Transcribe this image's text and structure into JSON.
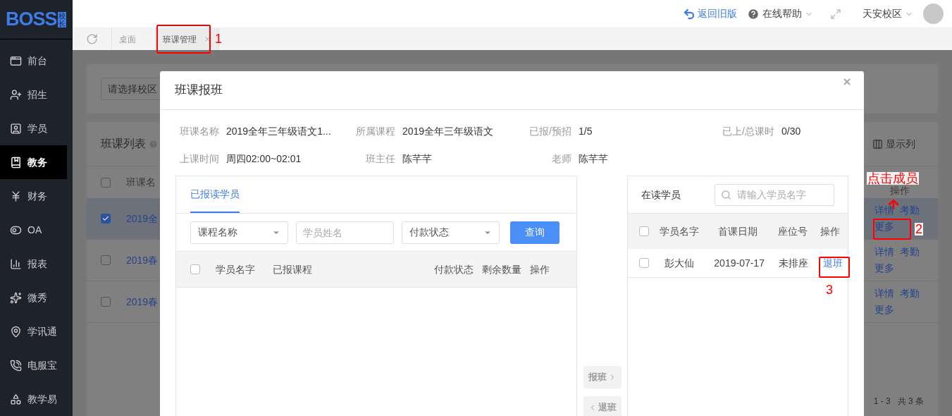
{
  "sidebar": {
    "logo": "BOSS",
    "logo_badge": "校长",
    "items": [
      {
        "label": "前台",
        "selected": false
      },
      {
        "label": "招生",
        "selected": false
      },
      {
        "label": "学员",
        "selected": false
      },
      {
        "label": "教务",
        "selected": true
      },
      {
        "label": "财务",
        "selected": false
      },
      {
        "label": "OA",
        "selected": false
      },
      {
        "label": "报表",
        "selected": false
      },
      {
        "label": "微秀",
        "selected": false
      },
      {
        "label": "学讯通",
        "selected": false
      },
      {
        "label": "电服宝",
        "selected": false
      },
      {
        "label": "教学易",
        "selected": false
      }
    ]
  },
  "topbar": {
    "back_link": "返回旧版",
    "help": "在线帮助",
    "campus": "天安校区"
  },
  "tabs": [
    {
      "label": "桌面",
      "selected": false,
      "closable": false
    },
    {
      "label": "班课管理",
      "selected": true,
      "closable": true
    }
  ],
  "page": {
    "campus_select": "请选择校区",
    "list_title": "班课列表",
    "columns_toggle": "显示列",
    "table": {
      "header_checked": false,
      "columns": [
        "班课名",
        "操作"
      ],
      "rows": [
        {
          "name": "2019全",
          "checked": true,
          "selected": true,
          "actions": [
            "详情",
            "考勤",
            "更多"
          ]
        },
        {
          "name": "2019春",
          "checked": false,
          "selected": false,
          "actions": [
            "详情",
            "考勤",
            "更多"
          ]
        },
        {
          "name": "2019春",
          "checked": false,
          "selected": false,
          "actions": [
            "详情",
            "考勤",
            "更多"
          ]
        }
      ]
    },
    "pagination": "1 - 3",
    "total": "共 3 条"
  },
  "modal": {
    "title": "班课报班",
    "info": [
      {
        "label": "班课名称",
        "value": "2019全年三年级语文1..."
      },
      {
        "label": "所属课程",
        "value": "2019全年三年级语文"
      },
      {
        "label": "已报/预招",
        "value": "1/5"
      },
      {
        "label": "已上/总课时",
        "value": "0/30"
      },
      {
        "label": "上课时间",
        "value": "周四02:00~02:01"
      },
      {
        "label": "班主任",
        "value": "陈芊芊"
      },
      {
        "label": "老师",
        "value": "陈芊芊"
      }
    ],
    "left_panel": {
      "tab": "已报读学员",
      "header_checked": false,
      "filters": [
        {
          "kind": "select",
          "placeholder": "课程名称"
        },
        {
          "kind": "input",
          "placeholder": "学员姓名"
        },
        {
          "kind": "select",
          "placeholder": "付款状态"
        }
      ],
      "query_button": "查询",
      "columns": [
        "学员名字",
        "已报课程",
        "付款状态",
        "剩余数量",
        "操作"
      ]
    },
    "transfer_buttons": [
      {
        "label": "报班",
        "kind": "enroll",
        "disabled": true
      },
      {
        "label": "退班",
        "kind": "withdraw",
        "disabled": true
      }
    ],
    "right_panel": {
      "title": "在读学员",
      "header_checked": false,
      "search_placeholder": "请输入学员名字",
      "columns": [
        "学员名字",
        "首课日期",
        "座位号",
        "操作"
      ],
      "rows": [
        {
          "name": "彭大仙",
          "date": "2019-07-17",
          "seat": "未排座",
          "action": "退班",
          "checked": false
        }
      ]
    }
  },
  "annotations": {
    "step_1": "1",
    "hint": "点击成员",
    "step_2": "2",
    "step_3": "3"
  }
}
